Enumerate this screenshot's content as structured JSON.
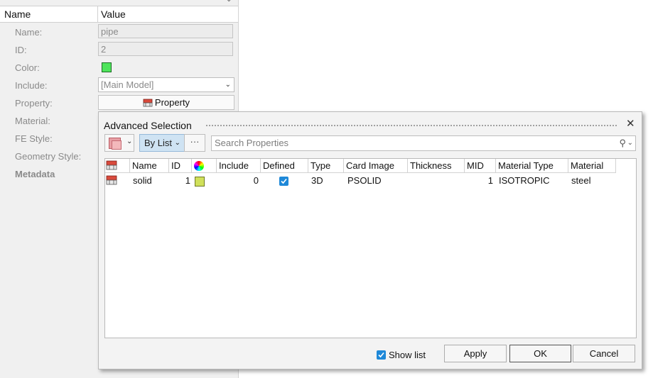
{
  "panel": {
    "header": {
      "name": "Name",
      "value": "Value"
    },
    "rows": {
      "name_label": "Name:",
      "name_value": "pipe",
      "id_label": "ID:",
      "id_value": "2",
      "color_label": "Color:",
      "include_label": "Include:",
      "include_value": "[Main Model]",
      "property_label": "Property:",
      "property_value": "Property",
      "material_label": "Material:",
      "fe_style_label": "FE Style:",
      "geometry_style_label": "Geometry Style:",
      "metadata_label": "Metadata"
    },
    "color_swatch": "#4ee45b"
  },
  "dialog": {
    "title": "Advanced Selection",
    "by_list": "By List",
    "more": "···",
    "search_placeholder": "Search Properties",
    "columns": [
      "Name",
      "ID",
      "Include",
      "Defined",
      "Type",
      "Card Image",
      "Thickness",
      "MID",
      "Material Type",
      "Material"
    ],
    "rows": [
      {
        "name": "solid",
        "id": "1",
        "color": "#d0e05a",
        "include": "0",
        "defined": true,
        "type": "3D",
        "card_image": "PSOLID",
        "thickness": "",
        "mid": "1",
        "material_type": "ISOTROPIC",
        "material": "steel"
      }
    ],
    "show_list": "Show list",
    "apply": "Apply",
    "ok": "OK",
    "cancel": "Cancel"
  }
}
